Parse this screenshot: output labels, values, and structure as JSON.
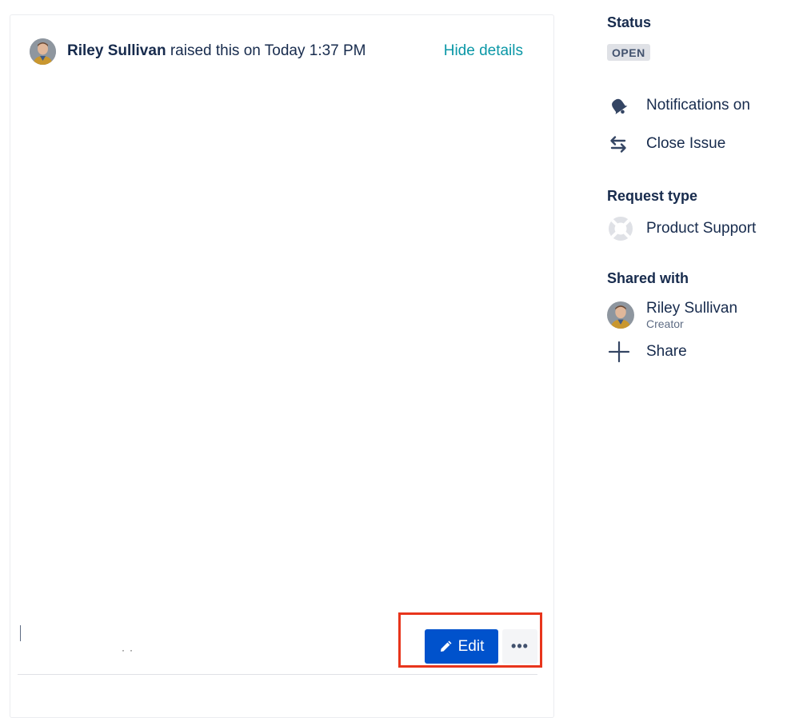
{
  "request": {
    "author": "Riley Sullivan",
    "raised_text": " raised this on Today 1:37 PM",
    "hide_details": "Hide details"
  },
  "actions": {
    "edit_label": "Edit",
    "more_label": "•••"
  },
  "sidebar": {
    "status_title": "Status",
    "status_value": "OPEN",
    "notifications_label": "Notifications on",
    "close_issue_label": "Close Issue",
    "request_type_title": "Request type",
    "request_type_value": "Product Support",
    "shared_with_title": "Shared with",
    "shared_user_name": "Riley Sullivan",
    "shared_user_role": "Creator",
    "share_label": "Share"
  },
  "colors": {
    "primary": "#0052cc",
    "link": "#0a97a6",
    "highlight": "#e8351c",
    "text": "#172b4d"
  }
}
